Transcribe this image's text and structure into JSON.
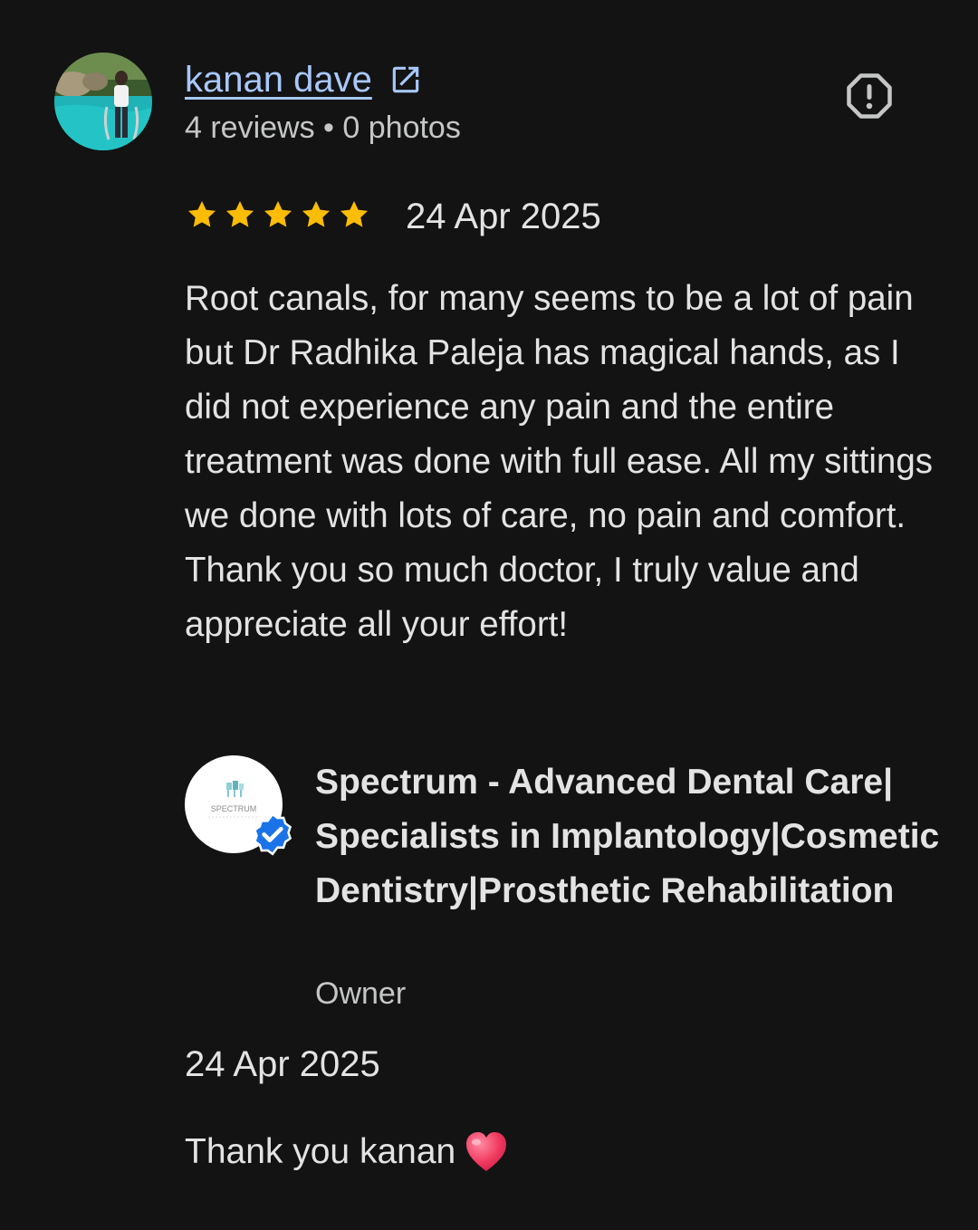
{
  "review": {
    "author": {
      "name": "kanan dave",
      "stats": "4 reviews • 0 photos",
      "avatar_icon": "avatar-photo",
      "link_icon": "open-in-new-icon"
    },
    "report_icon": "report-icon",
    "rating": {
      "value": 5,
      "max": 5,
      "star_color": "#fbbc04"
    },
    "date": "24 Apr 2025",
    "text": "Root canals, for many seems to be a lot of pain but Dr Radhika Paleja has magical hands, as I did not experience any pain and the entire treatment was done with full ease. All my sittings we done with lots of care, no pain and comfort. Thank you so much doctor, I truly value and appreciate all your effort!"
  },
  "owner_reply": {
    "business_name": "Spectrum - Advanced Dental Care| Specialists in Implantology|Cosmetic Dentistry|Prosthetic Rehabilitation",
    "role": "Owner",
    "logo_text": "SPECTRUM",
    "verified_icon": "verified-badge-icon",
    "date": "24 Apr 2025",
    "text": "Thank you kanan",
    "emoji_icon": "heart-icon"
  },
  "colors": {
    "background": "#131313",
    "link": "#a8c7fa",
    "text": "#e3e3e3",
    "secondary": "#c4c7c5",
    "verified": "#1a73e8"
  }
}
